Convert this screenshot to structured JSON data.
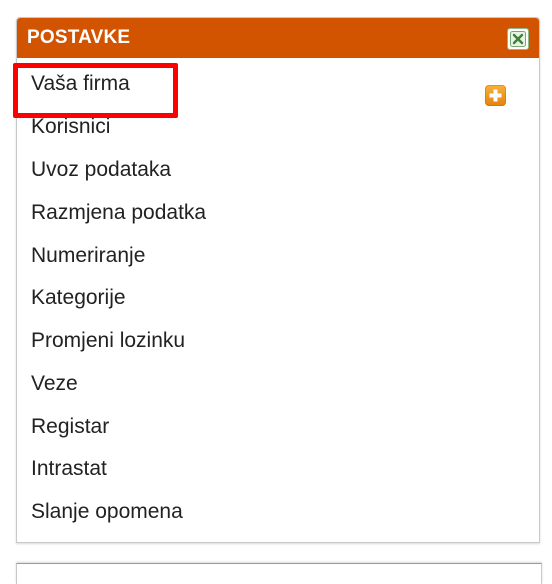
{
  "panel": {
    "title": "POSTAVKE",
    "header_color": "#d35400"
  },
  "menu": {
    "items": [
      {
        "label": "Vaša firma"
      },
      {
        "label": "Korisnici"
      },
      {
        "label": "Uvoz podataka"
      },
      {
        "label": "Razmjena podatka"
      },
      {
        "label": "Numeriranje"
      },
      {
        "label": "Kategorije"
      },
      {
        "label": "Promjeni lozinku"
      },
      {
        "label": "Veze"
      },
      {
        "label": "Registar"
      },
      {
        "label": "Intrastat"
      },
      {
        "label": "Slanje opomena"
      }
    ]
  },
  "icons": {
    "close": "close-icon",
    "add": "plus-icon"
  },
  "highlight_color": "#ff0000"
}
